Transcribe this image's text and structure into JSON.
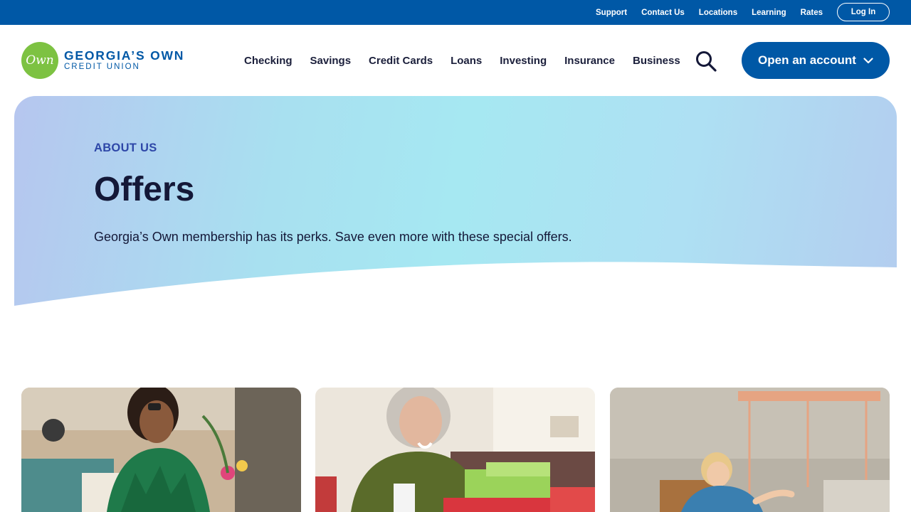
{
  "utility_nav": {
    "links": [
      "Support",
      "Contact Us",
      "Locations",
      "Learning",
      "Rates"
    ],
    "login_label": "Log In"
  },
  "header": {
    "logo": {
      "mark": "Own",
      "line1": "GEORGIA’S OWN",
      "line2": "CREDIT UNION"
    },
    "nav": [
      "Checking",
      "Savings",
      "Credit Cards",
      "Loans",
      "Investing",
      "Insurance",
      "Business"
    ],
    "search_icon": "search-icon",
    "cta_label": "Open an account"
  },
  "hero": {
    "eyebrow": "ABOUT US",
    "title": "Offers",
    "description": "Georgia’s Own membership has its perks. Save even more with these special offers."
  },
  "cards": [
    {
      "image": "woman-phone-cafe-photo"
    },
    {
      "image": "woman-wrapping-gifts-photo"
    },
    {
      "image": "woman-installing-light-photo"
    }
  ],
  "colors": {
    "brand_blue": "#0058a6",
    "logo_green": "#7dc242",
    "heading_navy": "#141838",
    "eyebrow_blue": "#2e47a8"
  }
}
